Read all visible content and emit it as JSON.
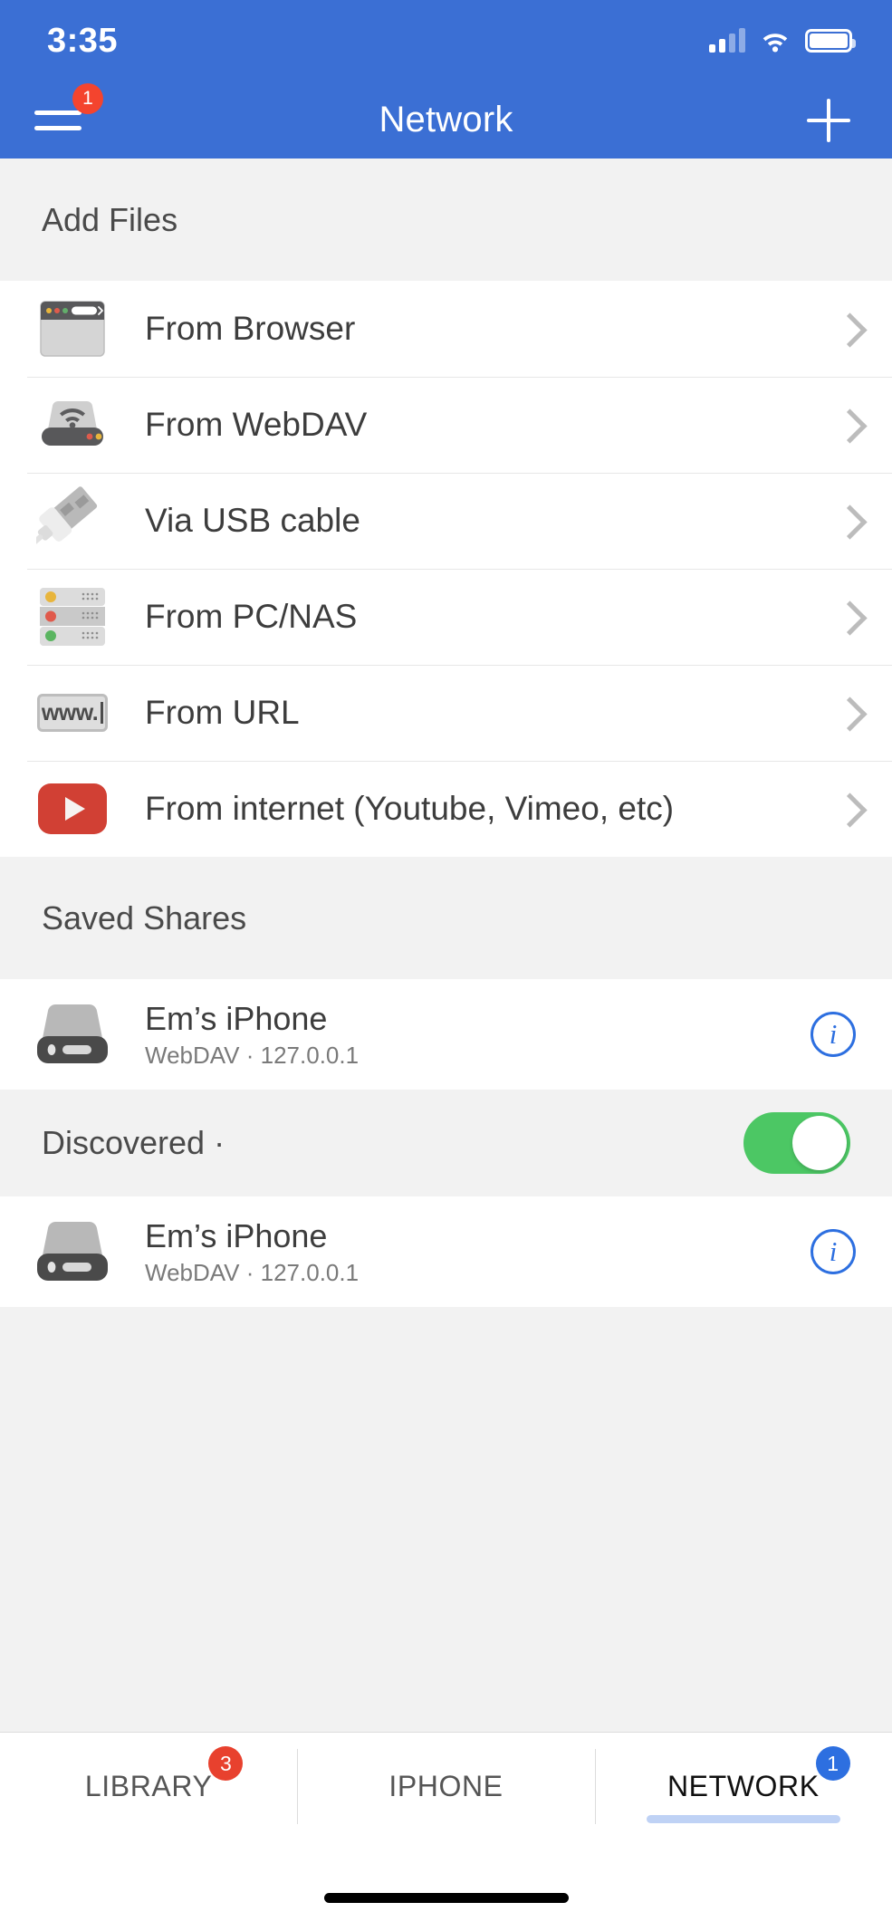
{
  "statusbar": {
    "time": "3:35",
    "signal_icon": "cellular-signal-icon",
    "wifi_icon": "wifi-icon",
    "battery_icon": "battery-full-icon"
  },
  "navbar": {
    "title": "Network",
    "menu_icon": "hamburger-menu-icon",
    "menu_badge": "1",
    "add_icon": "plus-icon"
  },
  "sections": {
    "add_files": {
      "header": "Add Files",
      "items": [
        {
          "label": "From Browser",
          "icon": "browser-window-icon"
        },
        {
          "label": "From WebDAV",
          "icon": "webdav-drive-icon"
        },
        {
          "label": "Via USB cable",
          "icon": "usb-cable-icon"
        },
        {
          "label": "From PC/NAS",
          "icon": "nas-server-icon"
        },
        {
          "label": "From URL",
          "icon": "url-address-icon"
        },
        {
          "label": "From internet (Youtube, Vimeo, etc)",
          "icon": "youtube-play-icon"
        }
      ]
    },
    "saved_shares": {
      "header": "Saved Shares",
      "items": [
        {
          "title": "Em’s iPhone",
          "subtitle": "WebDAV · 127.0.0.1",
          "icon": "external-drive-icon",
          "info_icon": "info-circle-icon"
        }
      ]
    },
    "discovered": {
      "header": "Discovered ·",
      "toggle_on": true,
      "items": [
        {
          "title": "Em’s iPhone",
          "subtitle": "WebDAV · 127.0.0.1",
          "icon": "external-drive-icon",
          "info_icon": "info-circle-icon"
        }
      ]
    }
  },
  "tabbar": {
    "tabs": [
      {
        "label": "LIBRARY",
        "badge": "3",
        "badge_color": "red",
        "active": false
      },
      {
        "label": "IPHONE",
        "badge": "",
        "badge_color": "",
        "active": false
      },
      {
        "label": "NETWORK",
        "badge": "1",
        "badge_color": "blue",
        "active": true
      }
    ]
  },
  "url_icon_text": "www.",
  "colors": {
    "header_blue": "#3B6FD4",
    "accent_blue": "#2D6FE0",
    "badge_red": "#E8412E",
    "toggle_green": "#4CC764",
    "section_bg": "#F2F2F2",
    "youtube_red": "#D14034"
  }
}
